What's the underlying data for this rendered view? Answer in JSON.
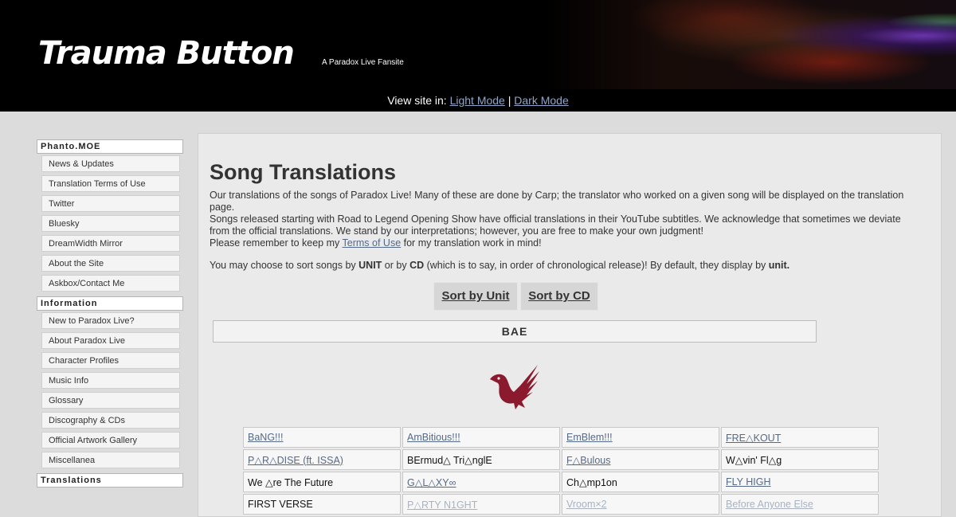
{
  "header": {
    "title": "Trauma Button",
    "tagline": "A Paradox Live Fansite",
    "view_prefix": "View site in:",
    "light_mode": "Light Mode",
    "separator": "|",
    "dark_mode": "Dark Mode"
  },
  "sidebar": {
    "sections": [
      {
        "heading": "Phanto.MOE",
        "items": [
          "News & Updates",
          "Translation Terms of Use",
          "Twitter",
          "Bluesky",
          "DreamWidth Mirror",
          "About the Site",
          "Askbox/Contact Me"
        ]
      },
      {
        "heading": "Information",
        "items": [
          "New to Paradox Live?",
          "About Paradox Live",
          "Character Profiles",
          "Music Info",
          "Glossary",
          "Discography & CDs",
          "Official Artwork Gallery",
          "Miscellanea"
        ]
      },
      {
        "heading": "Translations",
        "items": []
      }
    ]
  },
  "main": {
    "title": "Song Translations",
    "intro_line1": "Our translations of the songs of Paradox Live! Many of these are done by Carp; the translator who worked on a given song will be displayed on the translation page.",
    "intro_line2": "Songs released starting with Road to Legend Opening Show have official translations in their YouTube subtitles. We acknowledge that sometimes we deviate from the official translations. We stand by our interpretations; however, you are free to make your own judgment!",
    "intro_line3_pre": "Please remember to keep my ",
    "terms_link": "Terms of Use",
    "intro_line3_post": " for my translation work in mind!",
    "sort_pre": "You may choose to sort songs by ",
    "sort_unit_word": "UNIT",
    "sort_mid1": " or by ",
    "sort_cd_word": "CD",
    "sort_mid2": " (which is to say, in order of chronological release)! By default, they display by ",
    "sort_default_word": "unit.",
    "sort_by_unit": "Sort by Unit",
    "sort_by_cd": "Sort by CD",
    "unit_name": "BAE",
    "logo_color": "#8b1a2e",
    "songs": [
      [
        {
          "t": "BaNG!!!",
          "s": "link"
        },
        {
          "t": "AmBitious!!!",
          "s": "link"
        },
        {
          "t": "EmBlem!!!",
          "s": "link"
        },
        {
          "t": "FRE△KOUT",
          "s": "link"
        }
      ],
      [
        {
          "t": "P△R△DISE (ft. ISSA)",
          "s": "link"
        },
        {
          "t": "BErmud△ Tri△nglE",
          "s": "plain"
        },
        {
          "t": "F△Bulous",
          "s": "link"
        },
        {
          "t": "W△vin' Fl△g",
          "s": "plain"
        }
      ],
      [
        {
          "t": "We △re The Future",
          "s": "plain"
        },
        {
          "t": "G△L△XY∞",
          "s": "link"
        },
        {
          "t": "Ch△mp1on",
          "s": "plain"
        },
        {
          "t": "FLY HIGH",
          "s": "link"
        }
      ],
      [
        {
          "t": "FIRST VERSE",
          "s": "plain"
        },
        {
          "t": "P△RTY N1GHT",
          "s": "dim"
        },
        {
          "t": "Vroom×2",
          "s": "dim"
        },
        {
          "t": "Before Anyone Else",
          "s": "dim"
        }
      ]
    ]
  }
}
